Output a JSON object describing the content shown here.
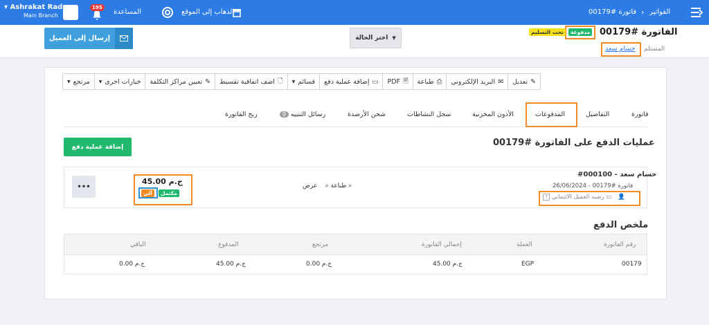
{
  "topbar": {
    "user_name": "Ashrakat Rady",
    "user_branch": "Main Branch",
    "notif_count": "195",
    "help": "المساعدة",
    "goto_site": "الذهاب إلى الموقع",
    "breadcrumb_root": "الفواتير",
    "breadcrumb_current": "فاتورة #00179"
  },
  "header": {
    "title": "الفاتورة #00179",
    "status_paid": "مدفوعة",
    "status_delivery": "تحت التسليم",
    "recipient_label": "المستلم",
    "recipient_name": "حسام سعد",
    "send_button": "إرسال إلى العميل",
    "status_select": "اختر الحالة"
  },
  "toolbar": {
    "edit": "تعديل",
    "email": "البريد الإلكتروني",
    "print": "طباعة",
    "pdf": "PDF",
    "add_payment": "إضافة عملية دفع",
    "vouchers": "قسائم",
    "installment": "اضف اتفاقية تقسيط",
    "cost_centers": "تعيين مراكز التكلفة",
    "more_options": "خيارات اخرى",
    "returned": "مرتجع"
  },
  "tabs": {
    "invoice": "فاتورة",
    "details": "التفاصيل",
    "payments": "المدفوعات",
    "stock_permissions": "الأذون المخزنية",
    "activity_log": "سجل النشاطات",
    "recharge_balances": "شحن الأرصدة",
    "reminders": "رسائل التنبيه",
    "reminders_count": "0",
    "invoice_profit": "ربح الفاتورة"
  },
  "payments_section": {
    "title": "عمليات الدفع على الفاتورة #00179",
    "add_button": "إضافة عملية دفع"
  },
  "payment": {
    "number_name": "#000100 - حسام سعد",
    "invoice_ref": "فاتورة #00179",
    "date": "26/06/2024",
    "method": "رصيد العميل الائتماني",
    "amount": "45.00 ج.م",
    "status_complete": "مكتمل",
    "status_auto": "آلي",
    "view": "عرض",
    "print": "طباعة",
    "more": "•••"
  },
  "summary": {
    "title": "ملخص الدفع",
    "columns": [
      "رقم الفاتورة",
      "العملة",
      "إجمالي الفاتورة",
      "مرتجع",
      "المدفوع",
      "الباقي"
    ],
    "row": [
      "00179",
      "EGP",
      "45.00 ج.م",
      "0.00 ج.م",
      "45.00 ج.م",
      "0.00 ج.م"
    ]
  },
  "colors": {
    "primary": "#2d7be5",
    "success": "#21b96e",
    "warning": "#f5d90a",
    "highlight": "#f08a24"
  }
}
